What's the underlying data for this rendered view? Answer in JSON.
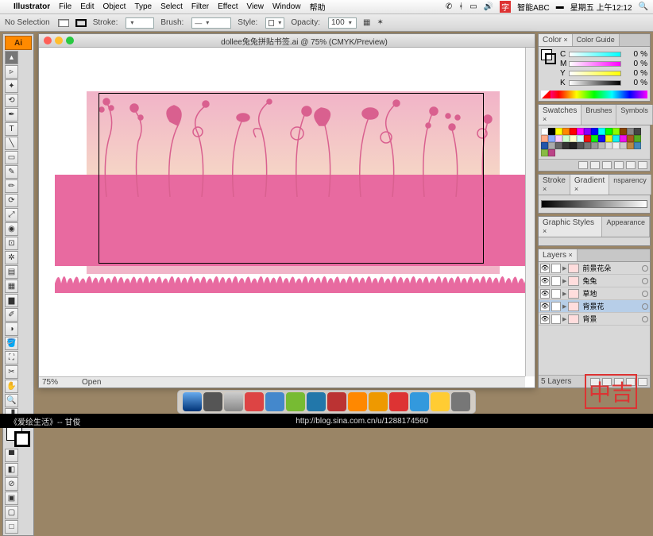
{
  "menubar": {
    "apple": "",
    "app": "Illustrator",
    "items": [
      "File",
      "Edit",
      "Object",
      "Type",
      "Select",
      "Filter",
      "Effect",
      "View",
      "Window",
      "帮助"
    ],
    "status": {
      "ime": "智能ABC",
      "day": "星期五 上午12:12"
    }
  },
  "controlbar": {
    "selection": "No Selection",
    "stroke_label": "Stroke:",
    "brush_label": "Brush:",
    "style_label": "Style:",
    "opacity_label": "Opacity:",
    "opacity_value": "100"
  },
  "document": {
    "title": "dollee兔兔拼贴书签.ai @ 75% (CMYK/Preview)",
    "zoom": "75%",
    "tool_status": "Open"
  },
  "panels": {
    "color": {
      "tabs": [
        "Color",
        "Color Guide"
      ],
      "channels": [
        {
          "l": "C",
          "v": "0",
          "c": "#0ff"
        },
        {
          "l": "M",
          "v": "0",
          "c": "#f0f"
        },
        {
          "l": "Y",
          "v": "0",
          "c": "#ff0"
        },
        {
          "l": "K",
          "v": "0",
          "c": "#000"
        }
      ],
      "unit": "%"
    },
    "swatches": {
      "tabs": [
        "Swatches",
        "Brushes",
        "Symbols"
      ],
      "colors": [
        "#fff",
        "#000",
        "#ff0",
        "#f80",
        "#f00",
        "#f0f",
        "#80f",
        "#00f",
        "#0ff",
        "#0f0",
        "#8f0",
        "#840",
        "#888",
        "#444",
        "#fa8",
        "#8af",
        "#fcf",
        "#cfc",
        "#ffc",
        "#cff",
        "#e11",
        "#1e1",
        "#11e",
        "#ee1",
        "#1ee",
        "#e1e",
        "#a52",
        "#5a2",
        "#25a",
        "#aaa",
        "#666",
        "#333",
        "#222",
        "#555",
        "#777",
        "#999",
        "#bbb",
        "#ddd",
        "#eee",
        "#ccc",
        "#b84",
        "#48b",
        "#8b4",
        "#b48"
      ]
    },
    "stroke": {
      "tabs": [
        "Stroke",
        "Gradient",
        "nsparency"
      ]
    },
    "styles": {
      "tabs": [
        "Graphic Styles",
        "Appearance"
      ]
    },
    "layers": {
      "tab": "Layers",
      "items": [
        {
          "name": "前景花朵",
          "sel": false
        },
        {
          "name": "兔兔",
          "sel": false
        },
        {
          "name": "草地",
          "sel": false
        },
        {
          "name": "背景花",
          "sel": true
        },
        {
          "name": "背景",
          "sel": false
        }
      ],
      "count": "5 Layers"
    }
  },
  "footer": {
    "left": "《爱绘生活》-- 甘俊",
    "url": "http://blog.sina.com.cn/u/1288174560"
  },
  "stamp": "中吉"
}
